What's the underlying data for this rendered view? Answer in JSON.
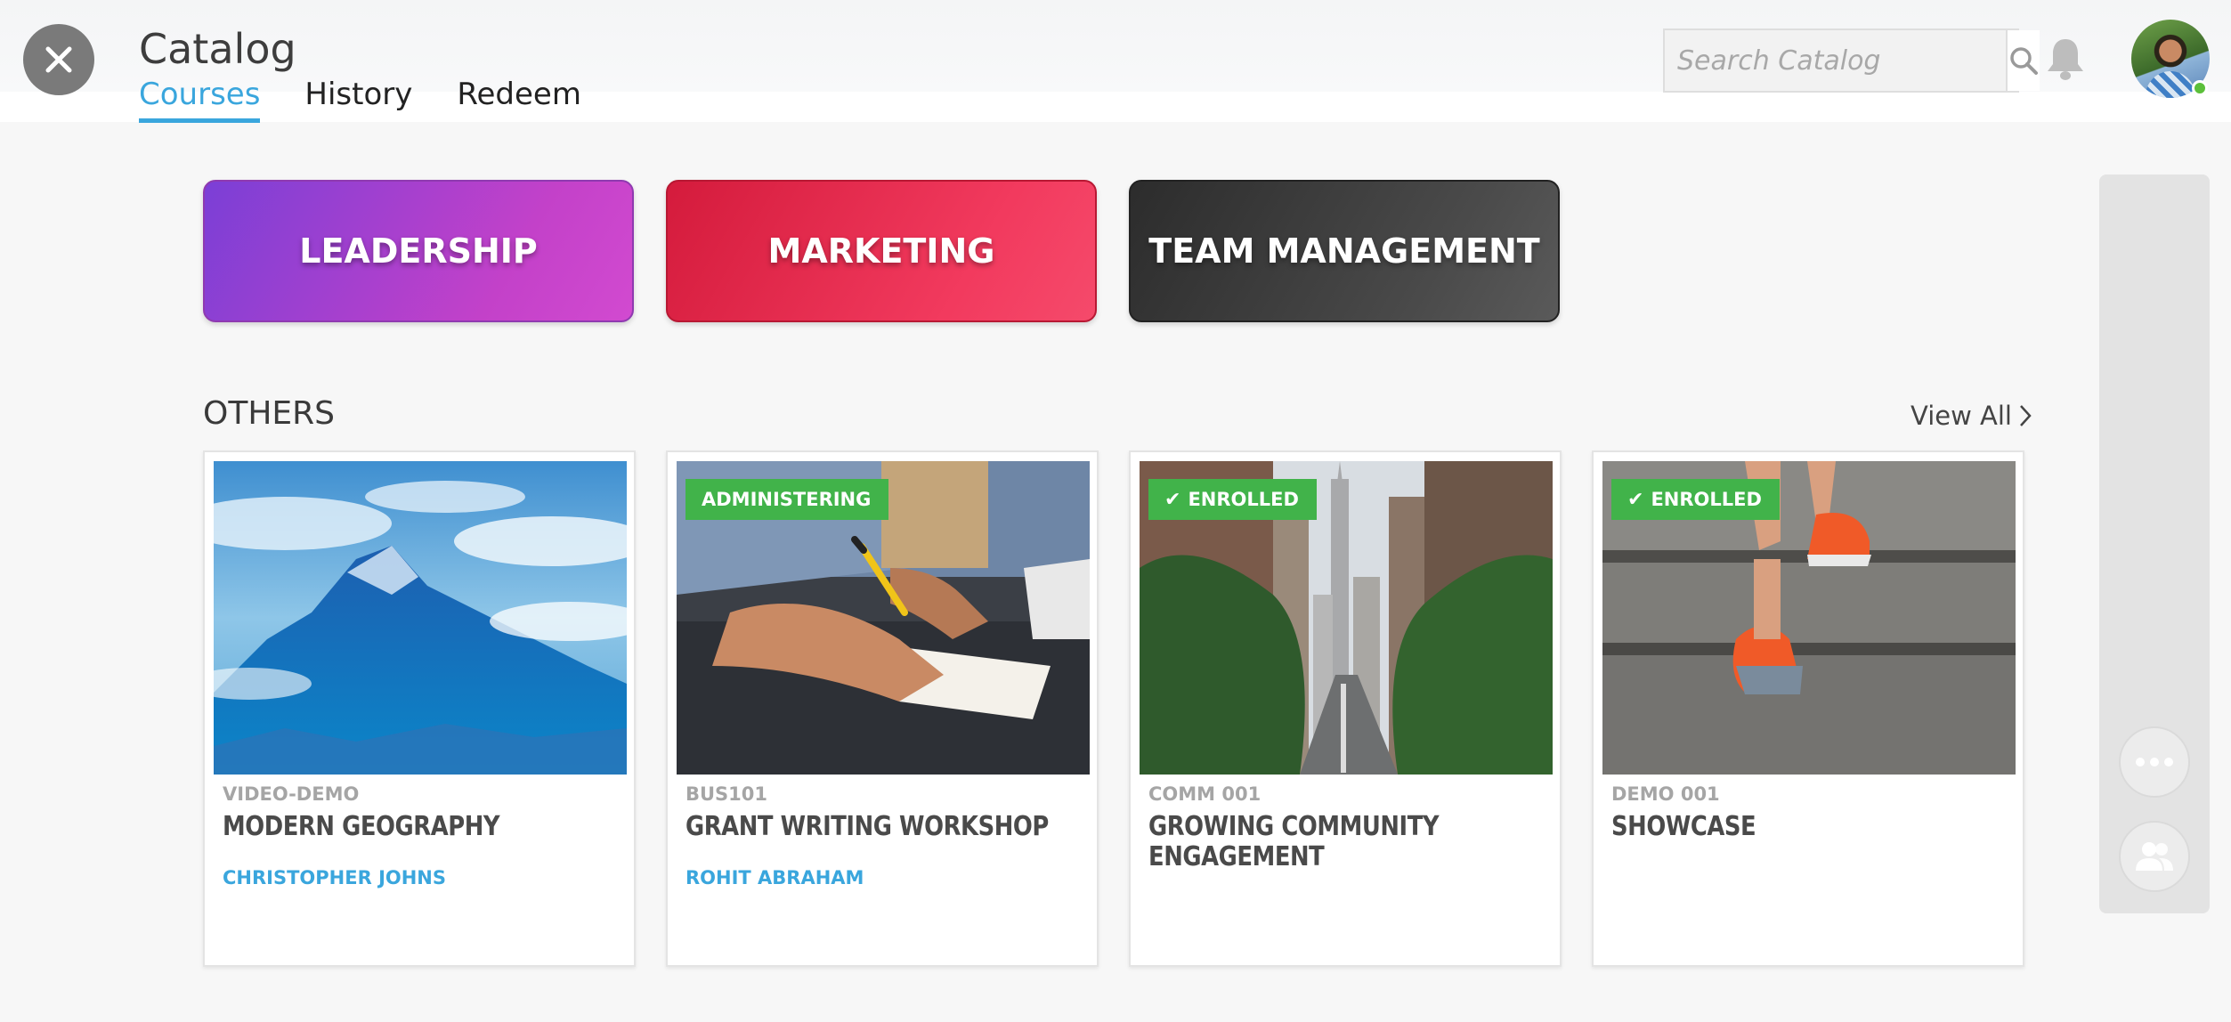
{
  "header": {
    "title": "Catalog",
    "tabs": [
      {
        "label": "Courses",
        "active": true
      },
      {
        "label": "History",
        "active": false
      },
      {
        "label": "Redeem",
        "active": false
      }
    ],
    "search": {
      "placeholder": "Search Catalog",
      "value": ""
    }
  },
  "categories": [
    {
      "label": "LEADERSHIP"
    },
    {
      "label": "MARKETING"
    },
    {
      "label": "TEAM MANAGEMENT"
    }
  ],
  "section": {
    "title": "OTHERS",
    "view_all": "View All"
  },
  "courses": [
    {
      "code": "VIDEO-DEMO",
      "title": "MODERN GEOGRAPHY",
      "author": "CHRISTOPHER JOHNS",
      "badge": ""
    },
    {
      "code": "BUS101",
      "title": "GRANT WRITING WORKSHOP",
      "author": "ROHIT ABRAHAM",
      "badge": "ADMINISTERING"
    },
    {
      "code": "COMM 001",
      "title": "GROWING COMMUNITY ENGAGEMENT",
      "author": "",
      "badge": "ENROLLED"
    },
    {
      "code": "DEMO 001",
      "title": "SHOWCASE",
      "author": "",
      "badge": "ENROLLED"
    }
  ],
  "icons": {
    "close": "close-icon",
    "search": "search-icon",
    "bell": "bell-icon",
    "more": "more-horizontal-icon",
    "people": "people-icon",
    "check": "check-icon",
    "chevron": "chevron-right-icon"
  },
  "colors": {
    "accent": "#3aa6dd",
    "badge_green": "#41b34a",
    "leadership": "#c341c9",
    "marketing": "#f23a5e",
    "team_management": "#3a3a3a"
  }
}
